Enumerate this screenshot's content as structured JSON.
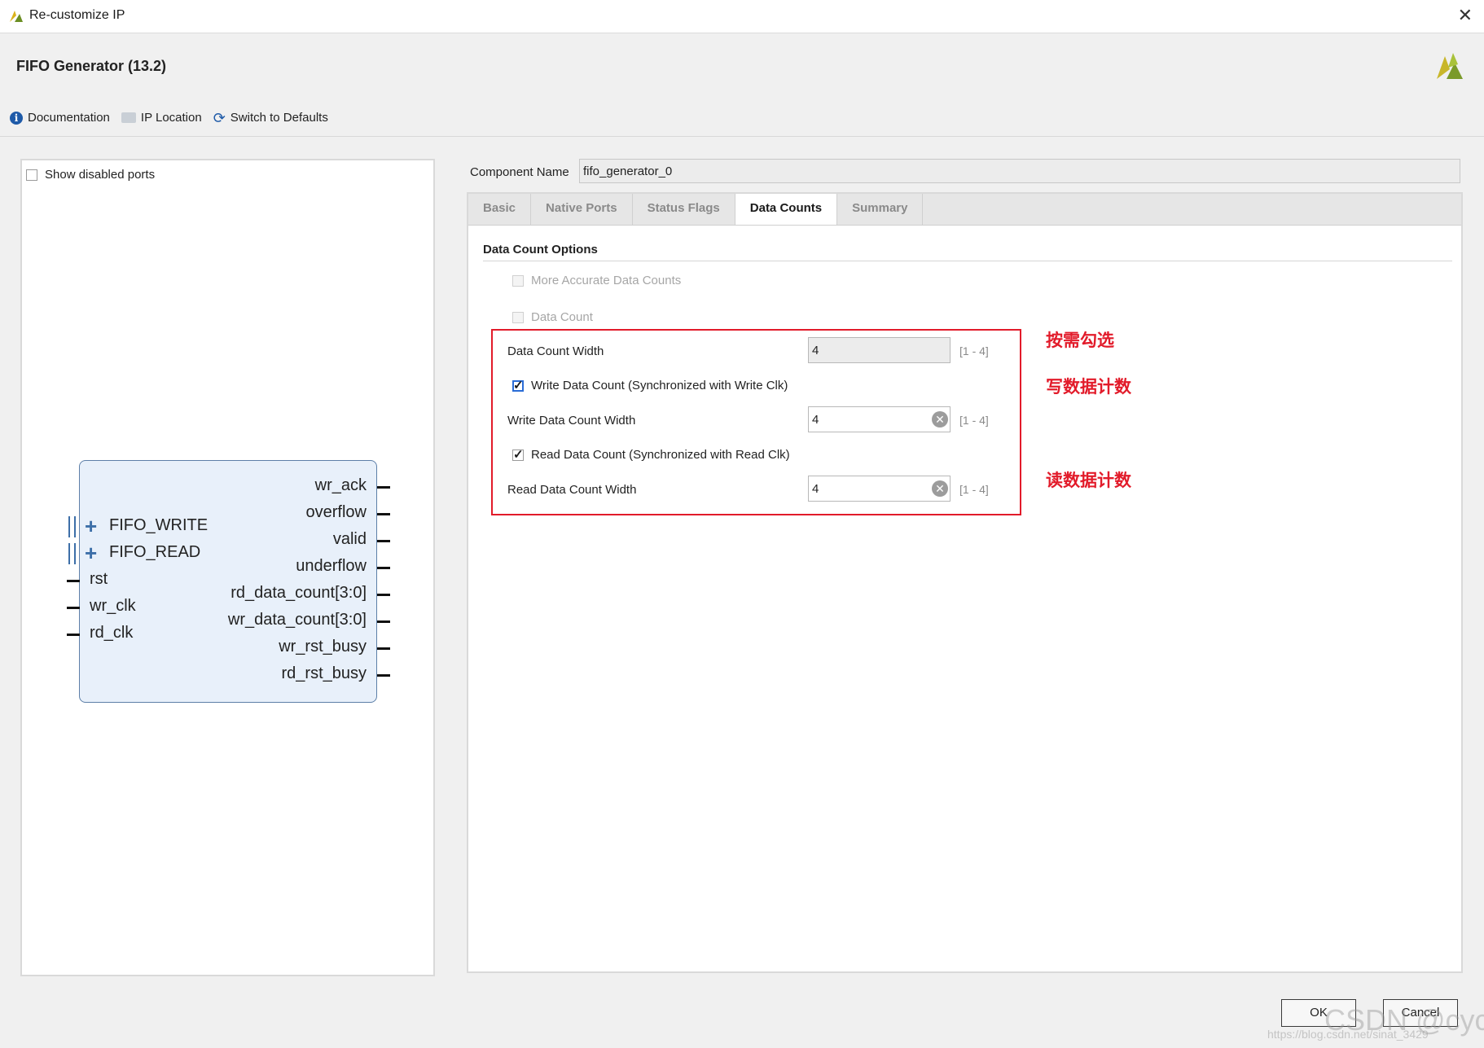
{
  "window": {
    "title": "Re-customize IP"
  },
  "header": {
    "ip_title": "FIFO Generator (13.2)"
  },
  "toolbar": {
    "documentation": "Documentation",
    "ip_location": "IP Location",
    "switch_defaults": "Switch to Defaults"
  },
  "left": {
    "show_disabled_label": "Show disabled ports",
    "block": {
      "left_bus_ports": [
        "FIFO_WRITE",
        "FIFO_READ"
      ],
      "left_ports": [
        "rst",
        "wr_clk",
        "rd_clk"
      ],
      "right_ports": [
        "wr_ack",
        "overflow",
        "valid",
        "underflow",
        "rd_data_count[3:0]",
        "wr_data_count[3:0]",
        "wr_rst_busy",
        "rd_rst_busy"
      ]
    }
  },
  "component": {
    "label": "Component Name",
    "value": "fifo_generator_0"
  },
  "tabs": [
    "Basic",
    "Native Ports",
    "Status Flags",
    "Data Counts",
    "Summary"
  ],
  "active_tab": "Data Counts",
  "data_counts": {
    "section_title": "Data Count Options",
    "more_accurate": {
      "label": "More Accurate Data Counts",
      "checked": false,
      "enabled": false
    },
    "data_count": {
      "label": "Data Count",
      "checked": false,
      "enabled": false
    },
    "data_count_width": {
      "label": "Data Count Width",
      "value": "4",
      "range": "[1 - 4]"
    },
    "write_data_count": {
      "label": "Write Data Count (Synchronized with Write Clk)",
      "checked": true
    },
    "write_data_count_width": {
      "label": "Write Data Count Width",
      "value": "4",
      "range": "[1 - 4]"
    },
    "read_data_count": {
      "label": "Read Data Count (Synchronized with Read Clk)",
      "checked": true
    },
    "read_data_count_width": {
      "label": "Read Data Count Width",
      "value": "4",
      "range": "[1 - 4]"
    }
  },
  "annotations": {
    "a1": "按需勾选",
    "a2": "写数据计数",
    "a3": "读数据计数",
    "highlight_color": "#e21b2a"
  },
  "buttons": {
    "ok": "OK",
    "cancel": "Cancel"
  },
  "watermark": {
    "main": "CSDN @cycf",
    "url": "https://blog.csdn.net/sinat_3429"
  }
}
